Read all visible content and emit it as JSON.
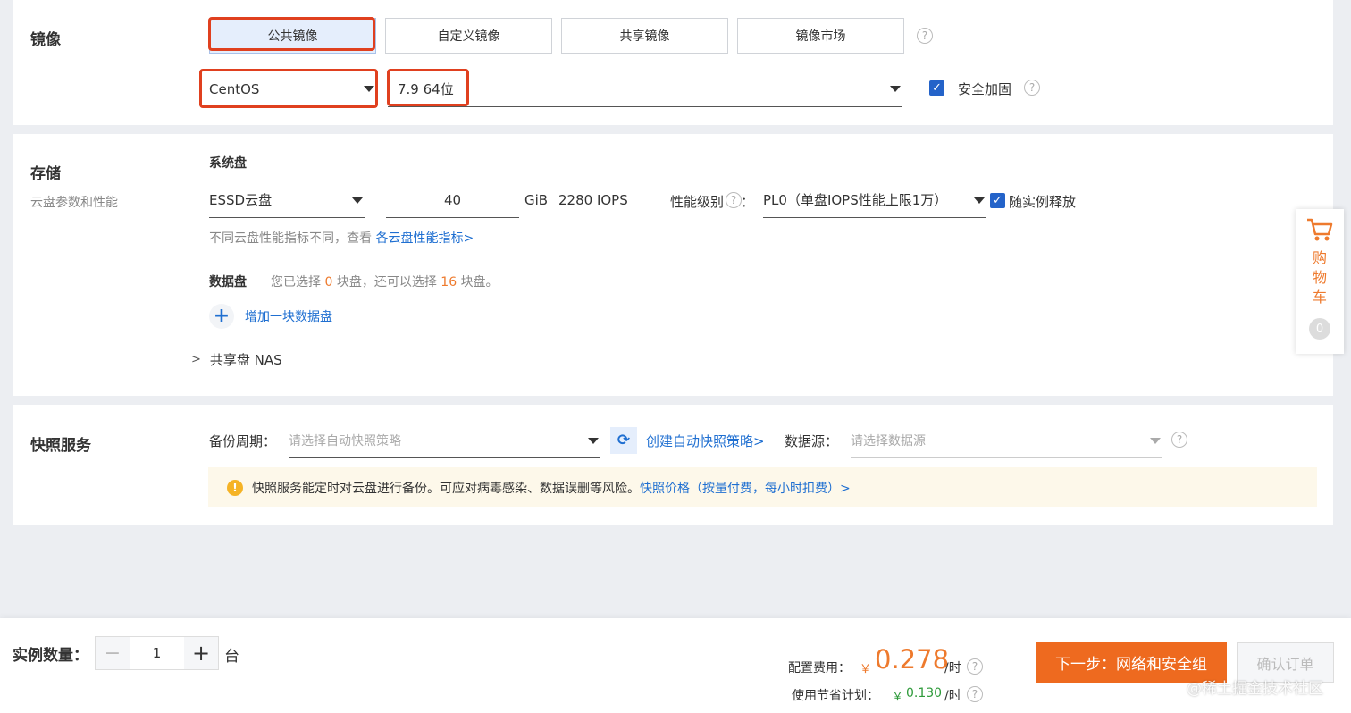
{
  "image": {
    "section_title": "镜像",
    "tabs": [
      {
        "label": "公共镜像",
        "active": true
      },
      {
        "label": "自定义镜像",
        "active": false
      },
      {
        "label": "共享镜像",
        "active": false
      },
      {
        "label": "镜像市场",
        "active": false
      }
    ],
    "os_value": "CentOS",
    "version_value": "7.9 64位",
    "security_label": "安全加固",
    "security_checked": true
  },
  "storage": {
    "section_title": "存储",
    "section_subtitle": "云盘参数和性能",
    "system_disk_label": "系统盘",
    "disk_type": "ESSD云盘",
    "disk_size": "40",
    "size_unit": "GiB",
    "iops": "2280 IOPS",
    "perf_label": "性能级别",
    "perf_colon": "：",
    "perf_value": "PL0（单盘IOPS性能上限1万）",
    "release_label": "随实例释放",
    "release_checked": true,
    "perf_note": "不同云盘性能指标不同，查看",
    "perf_link": "各云盘性能指标>",
    "data_disk_label": "数据盘",
    "data_disk_prefix": "您已选择",
    "data_disk_selected": "0",
    "data_disk_middle": "块盘，还可以选择",
    "data_disk_remaining": "16",
    "data_disk_suffix": "块盘。",
    "add_disk_label": "增加一块数据盘",
    "nas_label": "共享盘 NAS"
  },
  "snapshot": {
    "section_title": "快照服务",
    "backup_label": "备份周期：",
    "backup_placeholder": "请选择自动快照策略",
    "create_policy_link": "创建自动快照策略>",
    "source_label": "数据源：",
    "source_placeholder": "请选择数据源",
    "notice_text": "快照服务能定时对云盘进行备份。可应对病毒感染、数据误删等风险。",
    "notice_link": "快照价格（按量付费，每小时扣费）>"
  },
  "cart": {
    "label": [
      "购",
      "物",
      "车"
    ],
    "count": "0"
  },
  "footer": {
    "qty_label": "实例数量：",
    "qty_value": "1",
    "qty_unit": "台",
    "fee_label": "配置费用：",
    "currency": "￥",
    "fee_value": "0.278",
    "per_hour": "/时",
    "saving_label": "使用节省计划：",
    "saving_value": "0.130",
    "next_button": "下一步：网络和安全组",
    "confirm_button": "确认订单",
    "watermark": "@稀土掘金技术社区"
  },
  "colors": {
    "accent": "#1f6fd1",
    "highlight_border": "#e0401f",
    "next_button_bg": "#ee6a1f",
    "price": "#ee7a2d",
    "saving": "#2e9a3a"
  }
}
